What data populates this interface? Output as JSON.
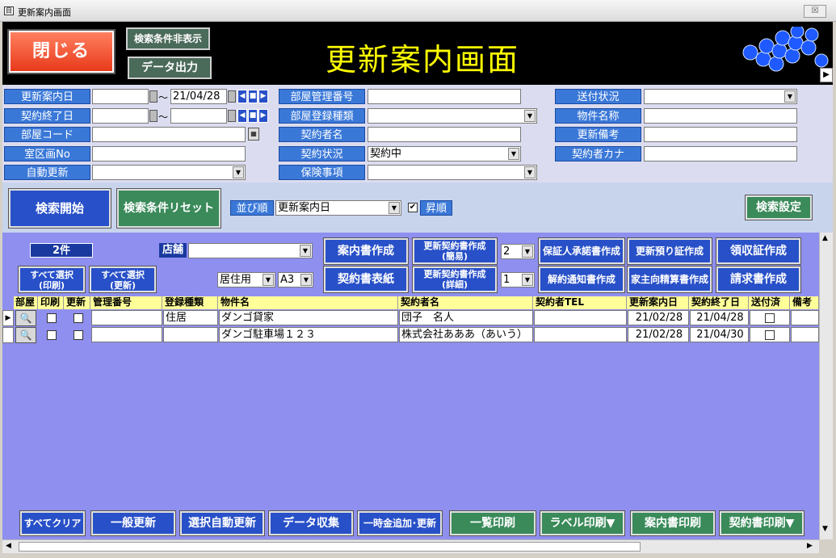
{
  "window": {
    "title": "更新案内画面",
    "close_glyph": "☒"
  },
  "header": {
    "close_label": "閉じる",
    "hide_conditions_label": "検索条件非表示",
    "export_label": "データ出力",
    "title": "更新案内画面"
  },
  "search": {
    "renewal_date_label": "更新案内日",
    "renewal_date_from": "",
    "renewal_date_to": "21/04/28",
    "tilde": "～",
    "contract_end_label": "契約終了日",
    "contract_end_from": "",
    "contract_end_to": "",
    "room_code_label": "部屋コード",
    "room_code_value": "",
    "room_section_label": "室区画No",
    "room_section_value": "",
    "auto_renew_label": "自動更新",
    "auto_renew_value": "",
    "room_mgmt_no_label": "部屋管理番号",
    "room_mgmt_no_value": "",
    "room_reg_type_label": "部屋登録種類",
    "room_reg_type_value": "",
    "contractor_name_label": "契約者名",
    "contractor_name_value": "",
    "contract_status_label": "契約状況",
    "contract_status_value": "契約中",
    "insurance_label": "保険事項",
    "insurance_value": "",
    "send_status_label": "送付状況",
    "send_status_value": "",
    "property_name_label": "物件名称",
    "property_name_value": "",
    "renewal_note_label": "更新備考",
    "renewal_note_value": "",
    "contractor_kana_label": "契約者カナ",
    "contractor_kana_value": ""
  },
  "controls": {
    "search_start_label": "検索開始",
    "reset_label": "検索条件リセット",
    "sort_label": "並び順",
    "sort_value": "更新案内日",
    "asc_label": "昇順",
    "asc_checked": true,
    "search_settings_label": "検索設定"
  },
  "list": {
    "count": "2件",
    "store_label": "店舗",
    "store_value": "",
    "select_all_print": "すべて選択\n(印刷)",
    "select_all_renew": "すべて選択\n(更新)",
    "residence_value": "居住用",
    "paper_value": "A3",
    "guide_create": "案内書作成",
    "contract_cover": "契約書表紙",
    "renew_contract_simple": "更新契約書作成\n(簡易)",
    "renew_contract_detail": "更新契約書作成\n(詳細)",
    "copies_1": "2",
    "copies_2": "1",
    "guarantor_consent": "保証人承諾書作成",
    "cancel_notice": "解約通知書作成",
    "renew_deposit": "更新預り証作成",
    "landlord_settlement": "家主向精算書作成",
    "receipt_create": "領収証作成",
    "invoice_create": "請求書作成",
    "columns": [
      "部屋",
      "印刷",
      "更新",
      "管理番号",
      "登録種類",
      "物件名",
      "契約者名",
      "契約者TEL",
      "更新案内日",
      "契約終了日",
      "送付済",
      "備考"
    ],
    "rows": [
      {
        "mgmt_no": "",
        "reg_type": "住居",
        "property": "ダンゴ貸家",
        "contractor": "団子　名人",
        "tel": "",
        "renewal_date": "21/02/28",
        "end_date": "21/04/28"
      },
      {
        "mgmt_no": "",
        "reg_type": "",
        "property": "ダンゴ駐車場１２３",
        "contractor": "株式会社あああ（あいう）",
        "tel": "",
        "renewal_date": "21/02/28",
        "end_date": "21/04/30"
      }
    ]
  },
  "footer": {
    "clear_all": "すべてクリア",
    "general_renew": "一般更新",
    "selected_auto_renew": "選択自動更新",
    "data_collect": "データ収集",
    "lump_add": "一時金追加･更新",
    "list_print": "一覧印刷",
    "label_print": "ラベル印刷▼",
    "guide_print": "案内書印刷",
    "contract_print": "契約書印刷▼"
  },
  "colors": {
    "header_bg": "#000000",
    "title_yellow": "#ffff00",
    "label_blue": "#3a78d8",
    "panel_purple": "#8f8fef",
    "grid_header": "#ffff99"
  }
}
